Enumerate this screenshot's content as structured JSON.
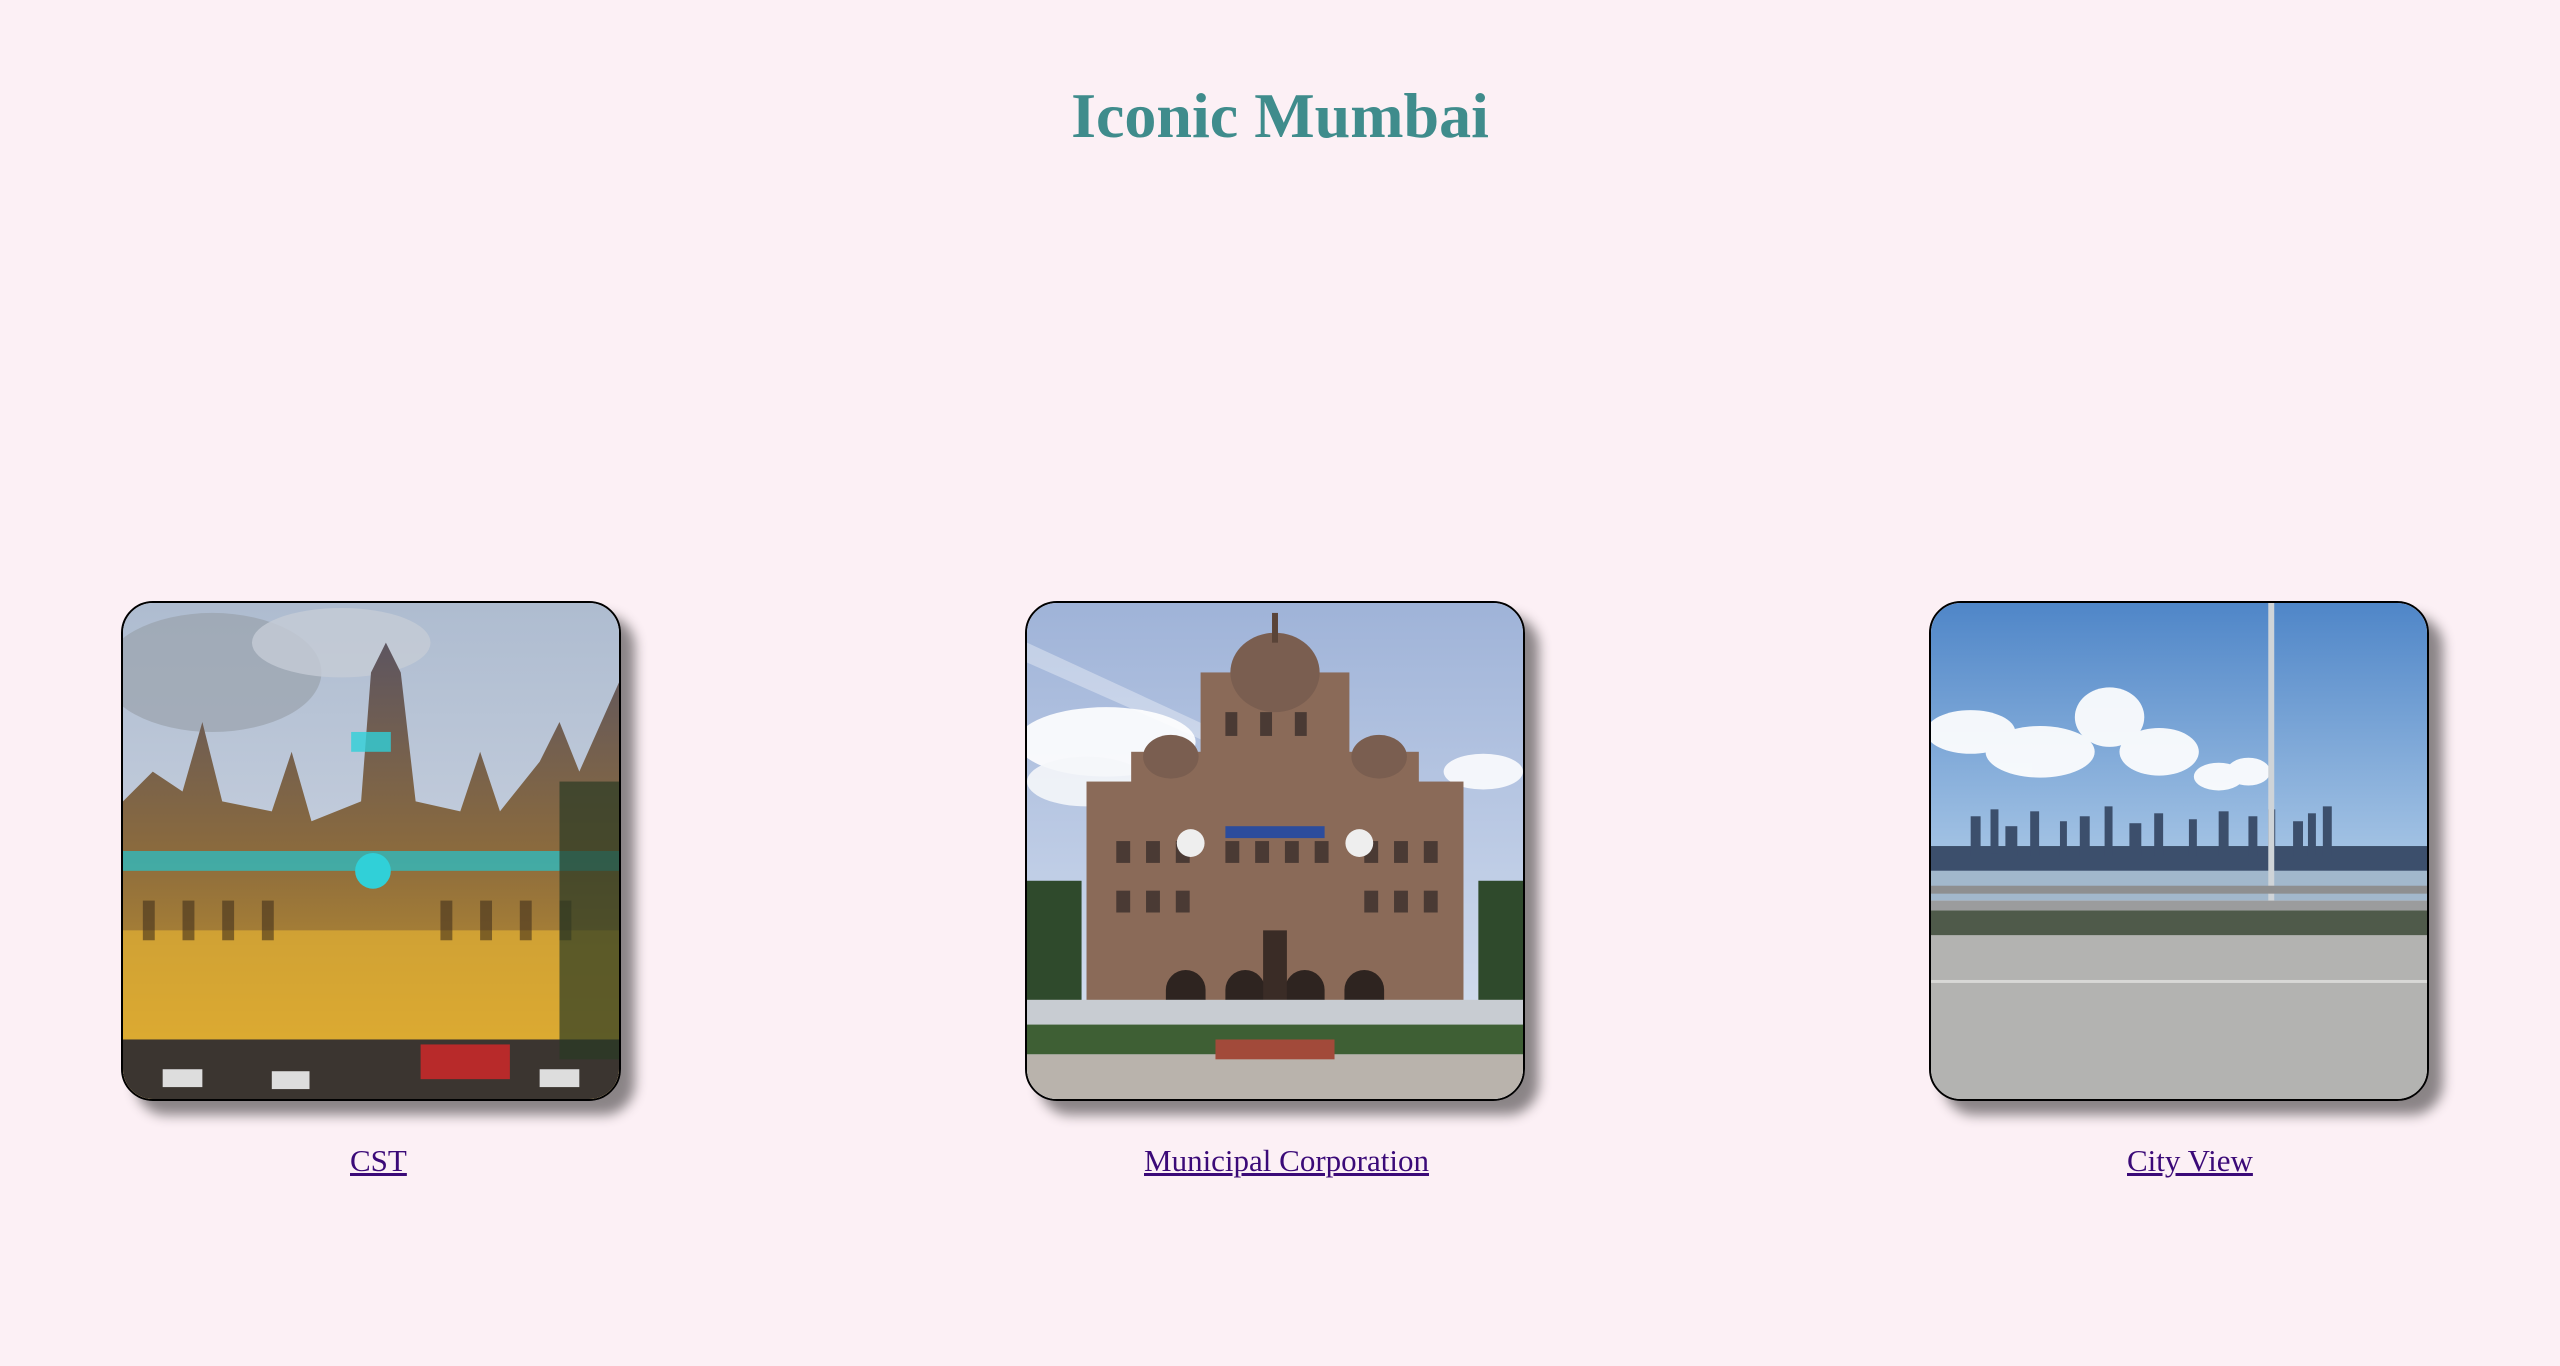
{
  "page": {
    "title": "Iconic Mumbai"
  },
  "cards": [
    {
      "link_label": "CST",
      "image_subject": "Chhatrapati Shivaji Terminus illuminated at night"
    },
    {
      "link_label": "Municipal Corporation",
      "image_subject": "Municipal Corporation building with dome"
    },
    {
      "link_label": "City View",
      "image_subject": "Mumbai skyline across the sea from a road"
    }
  ],
  "colors": {
    "background": "#fcf0f5",
    "title": "#3f8c8c",
    "link": "#3b0a78"
  }
}
